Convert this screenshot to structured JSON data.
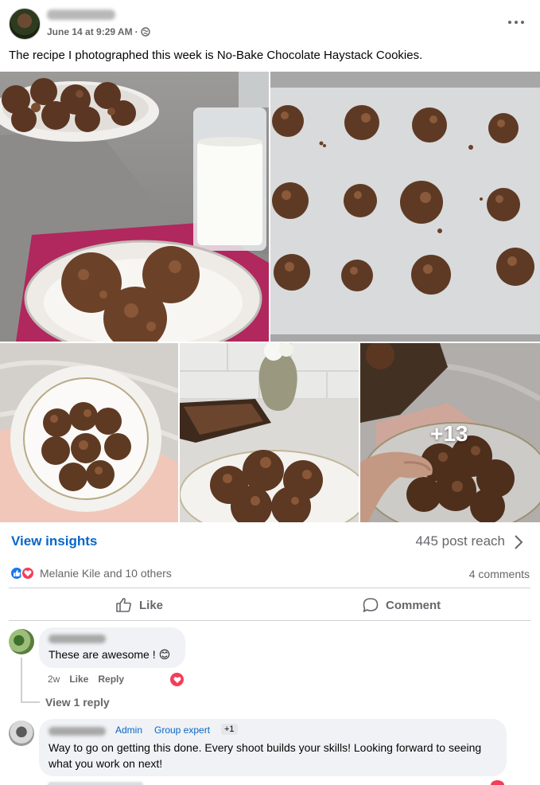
{
  "post": {
    "time": "June 14 at 9:29 AM",
    "separator": "·",
    "text": "The recipe I photographed this week is No-Bake Chocolate Haystack Cookies."
  },
  "photos": {
    "more_count": "+13"
  },
  "stats": {
    "insights_label": "View insights",
    "reach": "445 post reach",
    "reactions_text": "Melanie Kile and 10 others",
    "comments_count": "4 comments"
  },
  "actions": {
    "like": "Like",
    "comment": "Comment"
  },
  "comments": [
    {
      "text": "These are awesome !",
      "emoji": "😊",
      "age": "2w",
      "like": "Like",
      "reply": "Reply",
      "view_replies": "View 1 reply"
    },
    {
      "badge_admin": "Admin",
      "badge_expert": "Group expert",
      "badge_more": "+1",
      "text": "Way to go on getting this done. Every shoot builds your skills! Looking forward to seeing what you work on next!"
    }
  ],
  "colors": {
    "link_blue": "#0866c6",
    "like_blue": "#1877f2",
    "love_red": "#f33e58",
    "muted": "#65676b",
    "bubble": "#f0f2f5"
  },
  "icons": [
    "globe-icon",
    "more-icon",
    "chevron-right-icon",
    "like-reaction-icon",
    "love-reaction-icon",
    "thumbs-up-icon",
    "comment-icon",
    "heart-icon"
  ]
}
